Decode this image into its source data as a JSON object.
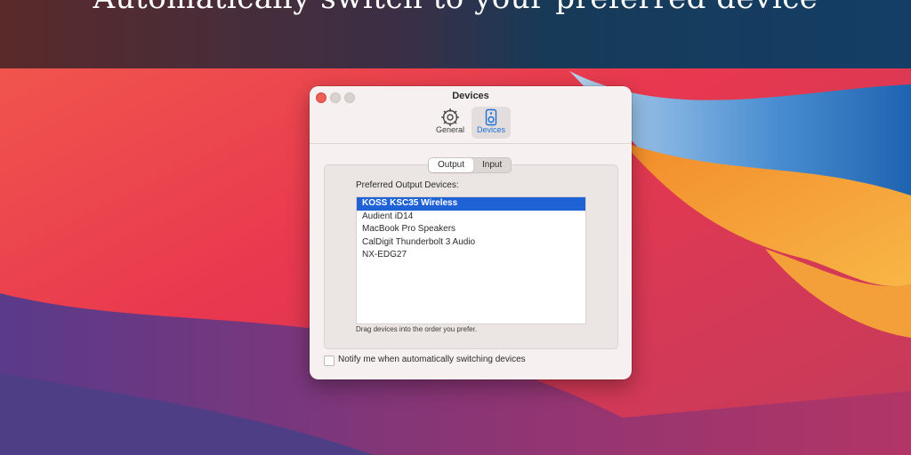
{
  "headline": "Automatically switch to your preferred device",
  "window": {
    "title": "Devices",
    "toolbar": [
      {
        "label": "General",
        "icon": "gear-icon"
      },
      {
        "label": "Devices",
        "icon": "speaker-icon"
      }
    ],
    "segmented": {
      "output_label": "Output",
      "input_label": "Input",
      "selected": "Output"
    },
    "preferred_label": "Preferred Output Devices:",
    "devices": [
      "KOSS KSC35 Wireless",
      "Audient iD14",
      "MacBook Pro Speakers",
      "CalDigit Thunderbolt 3 Audio",
      "NX-EDG27"
    ],
    "selected_device_index": 0,
    "hint": "Drag devices into the order you prefer.",
    "notify_label": "Notify me when automatically switching devices",
    "notify_checked": false
  },
  "colors": {
    "accent": "#1f62d6",
    "close": "#ed5f57"
  }
}
